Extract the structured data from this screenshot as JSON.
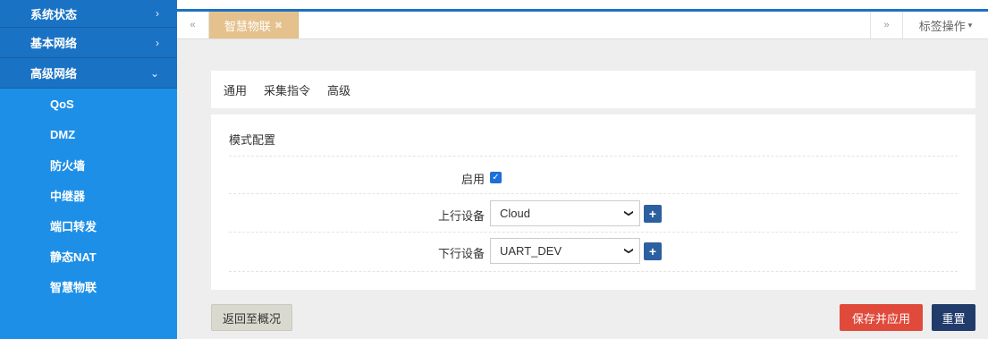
{
  "sidebar": {
    "groups": [
      {
        "label": "系统状态",
        "chevron": "›"
      },
      {
        "label": "基本网络",
        "chevron": "›"
      },
      {
        "label": "高级网络",
        "chevron": "⌄"
      }
    ],
    "subitems": [
      "QoS",
      "DMZ",
      "防火墙",
      "中继器",
      "端口转发",
      "静态NAT",
      "智慧物联"
    ]
  },
  "tabbar": {
    "prev_icon": "«",
    "active_tab": "智慧物联",
    "close_icon": "✖",
    "next_icon": "»",
    "ops_label": "标签操作",
    "ops_caret": "▾"
  },
  "subtabs": [
    "通用",
    "采集指令",
    "高级"
  ],
  "panel": {
    "title": "模式配置",
    "enable_label": "启用",
    "enable_checked": "✓",
    "uplink_label": "上行设备",
    "uplink_value": "Cloud",
    "downlink_label": "下行设备",
    "downlink_value": "UART_DEV",
    "select_arrow": "❯",
    "plus": "+"
  },
  "buttons": {
    "back": "返回至概况",
    "save": "保存并应用",
    "reset": "重置"
  },
  "colors": {
    "sidebar": "#1e8fe6",
    "sidebar_group": "#1a72c4",
    "active_tab": "#e5c28d",
    "save": "#e04a3b",
    "reset": "#213c6b",
    "checkbox": "#1e6fd9"
  }
}
